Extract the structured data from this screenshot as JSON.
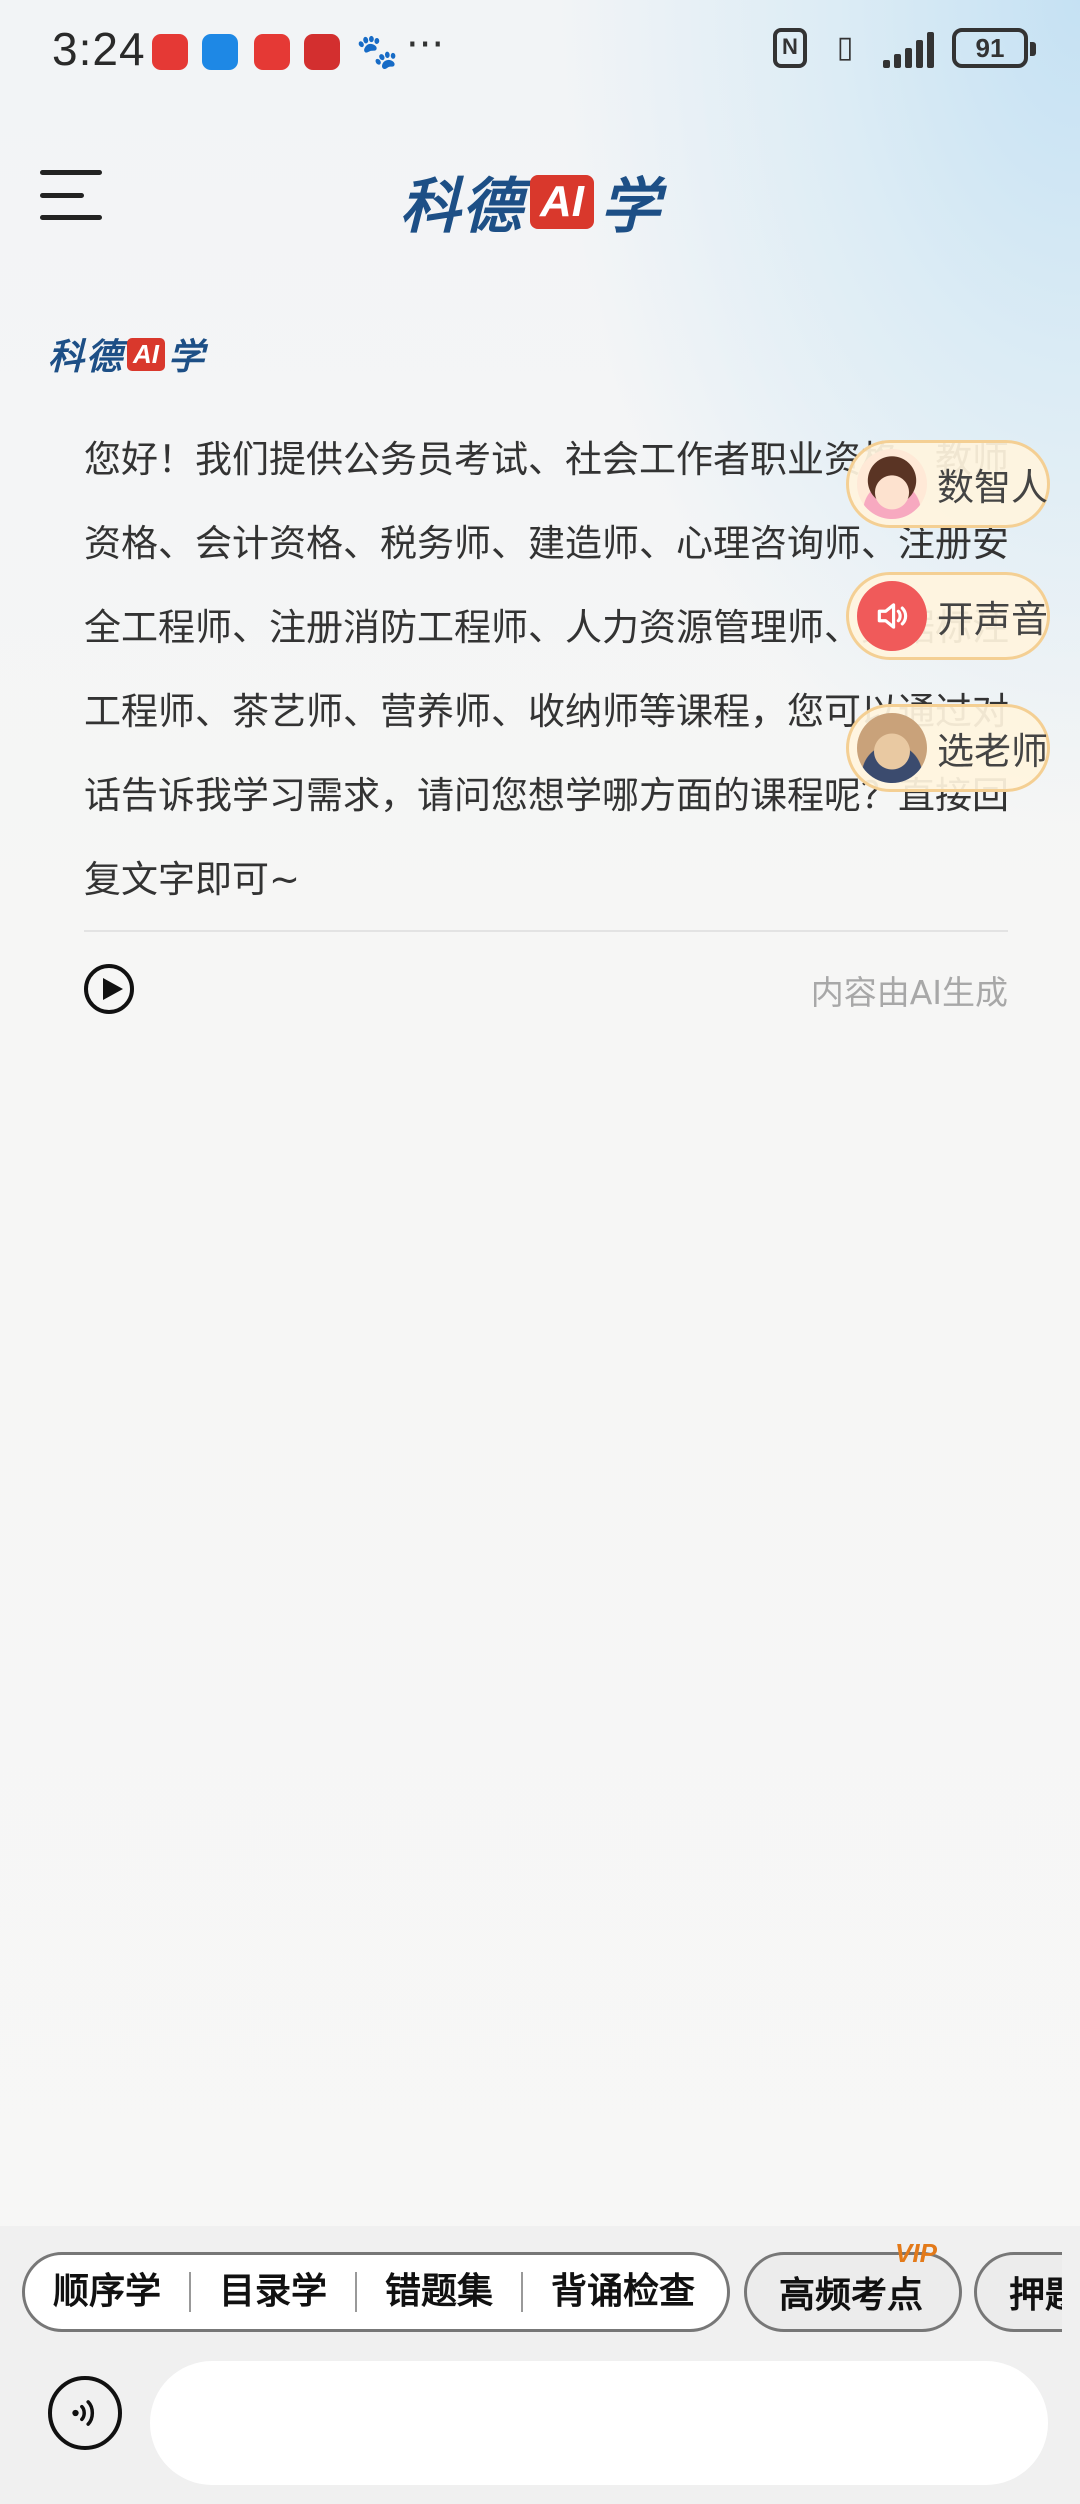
{
  "status_bar": {
    "time": "3:24",
    "battery": "91",
    "nfc": "N"
  },
  "header": {
    "brand_part1": "科德",
    "brand_ai": "AI",
    "brand_part2": "学"
  },
  "message": {
    "text": "您好！我们提供公务员考试、社会工作者职业资格、教师资格、会计资格、税务师、建造师、心理咨询师、注册安全工程师、注册消防工程师、人力资源管理师、数据标注工程师、茶艺师、营养师、收纳师等课程，您可以通过对话告诉我学习需求，请问您想学哪方面的课程呢？直接回复文字即可~",
    "ai_note": "内容由AI生成"
  },
  "floating": {
    "digital_human": "数智人",
    "sound_on": "开声音",
    "choose_teacher": "选老师"
  },
  "chips": {
    "group": [
      "顺序学",
      "目录学",
      "错题集",
      "背诵检查"
    ],
    "high_freq": "高频考点",
    "vip": "VIP",
    "next": "押题"
  },
  "input": {
    "placeholder": ""
  }
}
